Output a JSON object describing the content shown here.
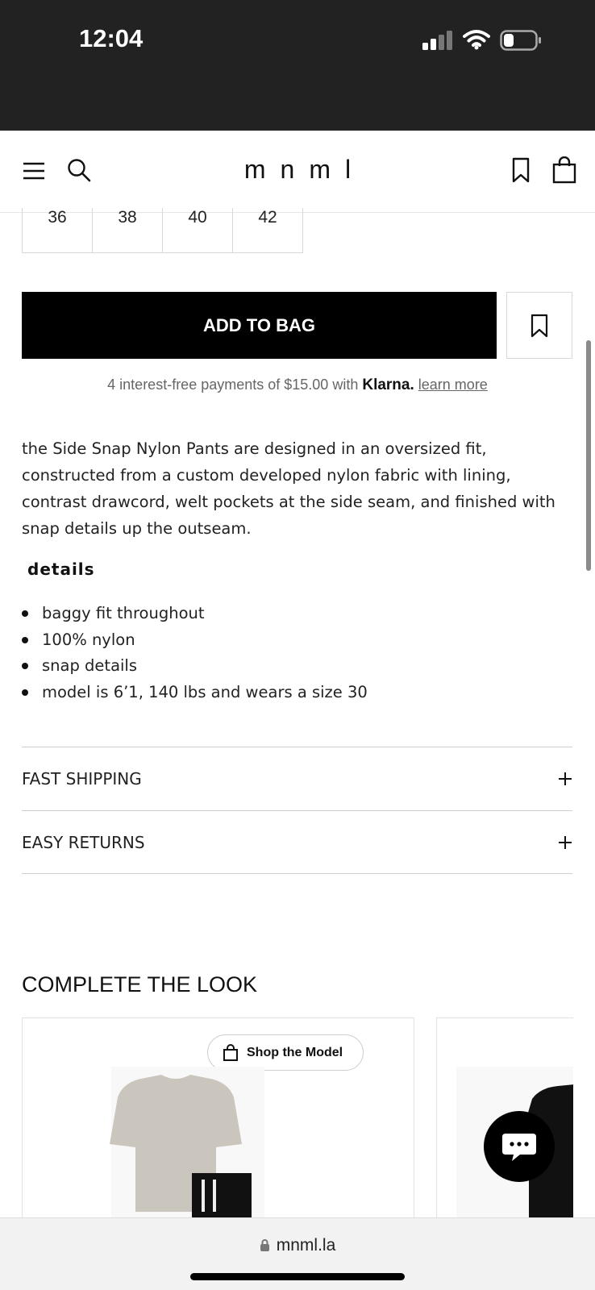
{
  "status": {
    "time": "12:04"
  },
  "header": {
    "logo": "mnml"
  },
  "sizes": [
    "36",
    "38",
    "40",
    "42"
  ],
  "product": {
    "add_to_bag_label": "ADD TO BAG",
    "klarna_text": "4 interest-free payments of $15.00 with",
    "klarna_brand": "Klarna.",
    "learn_more": "learn more",
    "description": "the Side Snap Nylon Pants are designed in an oversized fit, constructed from a custom developed nylon fabric with lining, contrast drawcord, welt pockets at the side seam, and finished with snap details up the outseam.",
    "details_title": "details",
    "details": [
      "baggy fit throughout",
      "100% nylon",
      "snap details",
      "model is 6’1, 140 lbs and wears a size 30"
    ]
  },
  "accordions": [
    "FAST SHIPPING",
    "EASY RETURNS"
  ],
  "complete_the_look": {
    "title": "COMPLETE THE LOOK",
    "shop_model_label": "Shop the Model"
  },
  "browser": {
    "url": "mnml.la"
  },
  "colors": {
    "status_bar": "#222222",
    "button": "#000000",
    "accent_text": "#666666"
  }
}
